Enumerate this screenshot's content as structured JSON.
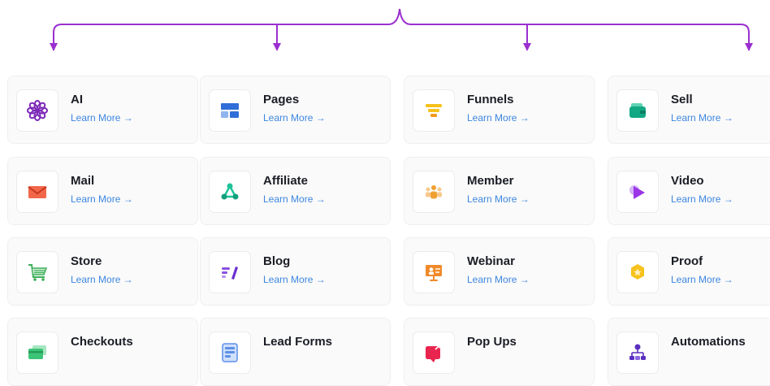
{
  "brace_color": "#9b2fd0",
  "learn_color": "#3d86e0",
  "cards": [
    {
      "title": "AI",
      "learn": "Learn More →",
      "icon": "ai-flower-icon"
    },
    {
      "title": "Pages",
      "learn": "Learn More →",
      "icon": "pages-layout-icon"
    },
    {
      "title": "Funnels",
      "learn": "Learn More →",
      "icon": "funnel-icon"
    },
    {
      "title": "Sell",
      "learn": "Learn More →",
      "icon": "wallet-icon"
    },
    {
      "title": "Mail",
      "learn": "Learn More →",
      "icon": "mail-icon"
    },
    {
      "title": "Affiliate",
      "learn": "Learn More →",
      "icon": "affiliate-network-icon"
    },
    {
      "title": "Member",
      "learn": "Learn More →",
      "icon": "member-group-icon"
    },
    {
      "title": "Video",
      "learn": "Learn More →",
      "icon": "video-play-icon"
    },
    {
      "title": "Store",
      "learn": "Learn More →",
      "icon": "store-cart-icon"
    },
    {
      "title": "Blog",
      "learn": "Learn More →",
      "icon": "blog-pen-icon"
    },
    {
      "title": "Webinar",
      "learn": "Learn More →",
      "icon": "webinar-presenter-icon"
    },
    {
      "title": "Proof",
      "learn": "Learn More →",
      "icon": "proof-badge-icon"
    },
    {
      "title": "Checkouts",
      "icon": "credit-card-icon"
    },
    {
      "title": "Lead Forms",
      "icon": "lead-form-icon"
    },
    {
      "title": "Pop Ups",
      "icon": "popup-icon"
    },
    {
      "title": "Automations",
      "icon": "automation-flow-icon"
    }
  ]
}
